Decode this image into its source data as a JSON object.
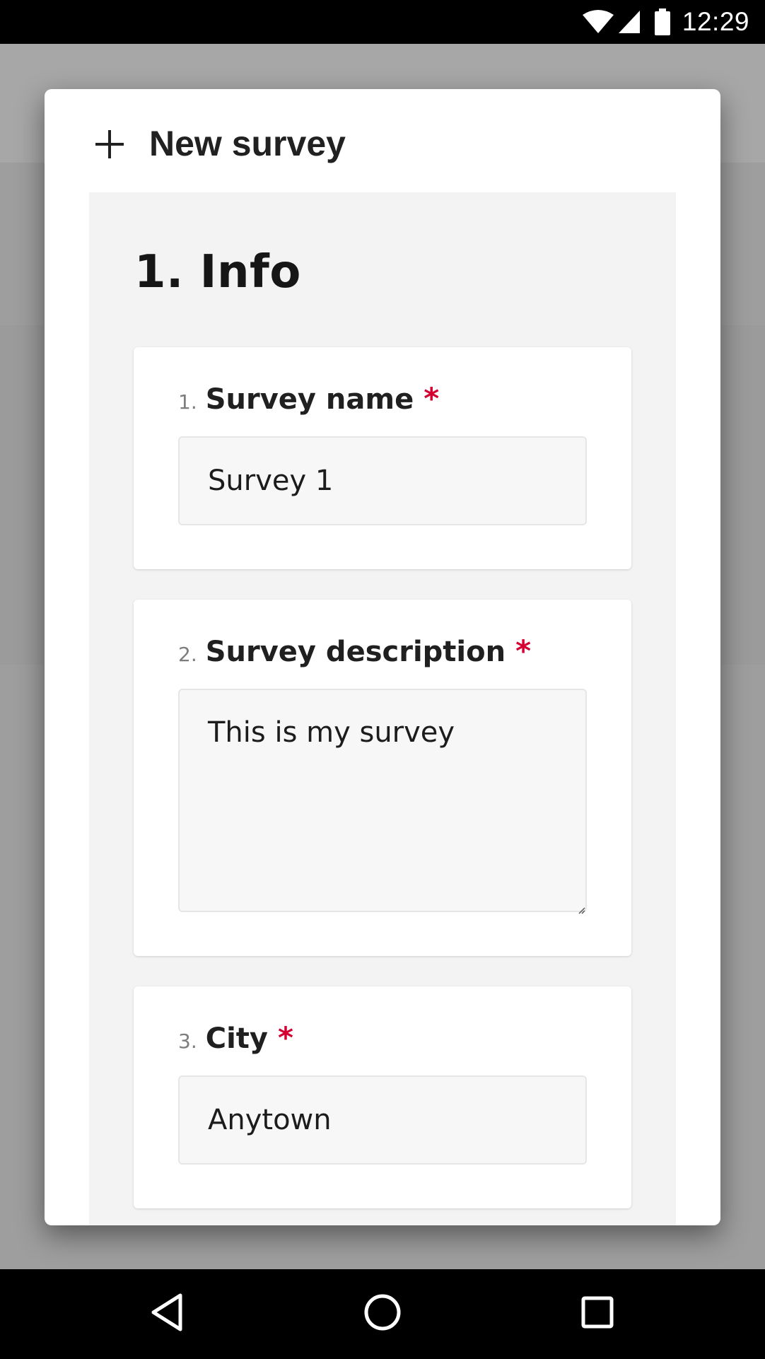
{
  "status_bar": {
    "time": "12:29",
    "icons": [
      "wifi-icon",
      "cell-signal-icon",
      "battery-icon"
    ]
  },
  "dialog": {
    "title": "New survey",
    "title_icon": "plus-icon",
    "section_title": "1. Info",
    "questions": [
      {
        "number": "1.",
        "title": "Survey name",
        "required_mark": "*",
        "value": "Survey 1",
        "type": "text"
      },
      {
        "number": "2.",
        "title": "Survey description",
        "required_mark": "*",
        "value": "This is my survey",
        "type": "textarea"
      },
      {
        "number": "3.",
        "title": "City",
        "required_mark": "*",
        "value": "Anytown",
        "type": "text"
      }
    ]
  },
  "nav_bar": {
    "buttons": [
      "back-icon",
      "home-icon",
      "recents-icon"
    ]
  },
  "colors": {
    "required": "#d50032",
    "status_bar": "#000000",
    "scrim": "#9e9e9e",
    "body_bg": "#f3f3f3"
  }
}
